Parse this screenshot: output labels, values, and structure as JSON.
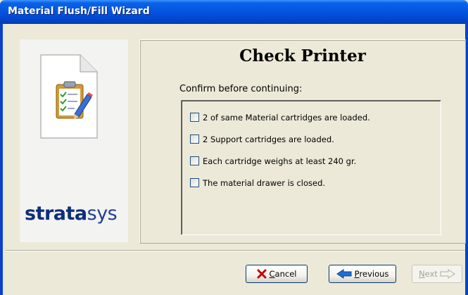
{
  "window": {
    "title": "Material Flush/Fill Wizard"
  },
  "brand": {
    "logo_bold": "strata",
    "logo_light": "sys"
  },
  "page": {
    "title": "Check Printer",
    "confirm_label": "Confirm before continuing:",
    "checklist": [
      {
        "label": "2 of same Material cartridges are loaded.",
        "checked": false
      },
      {
        "label": "2 Support cartridges are loaded.",
        "checked": false
      },
      {
        "label": "Each cartridge weighs at least 240 gr.",
        "checked": false
      },
      {
        "label": "The material drawer is closed.",
        "checked": false
      }
    ]
  },
  "buttons": {
    "cancel": {
      "mnemonic": "C",
      "rest": "ancel",
      "icon": "x-icon",
      "color": "#c00000"
    },
    "previous": {
      "mnemonic": "P",
      "rest": "revious",
      "icon": "back-arrow-icon",
      "color": "#1d6fd6"
    },
    "next": {
      "mnemonic": "N",
      "rest": "ext",
      "icon": "forward-arrow-icon",
      "enabled": false
    }
  }
}
